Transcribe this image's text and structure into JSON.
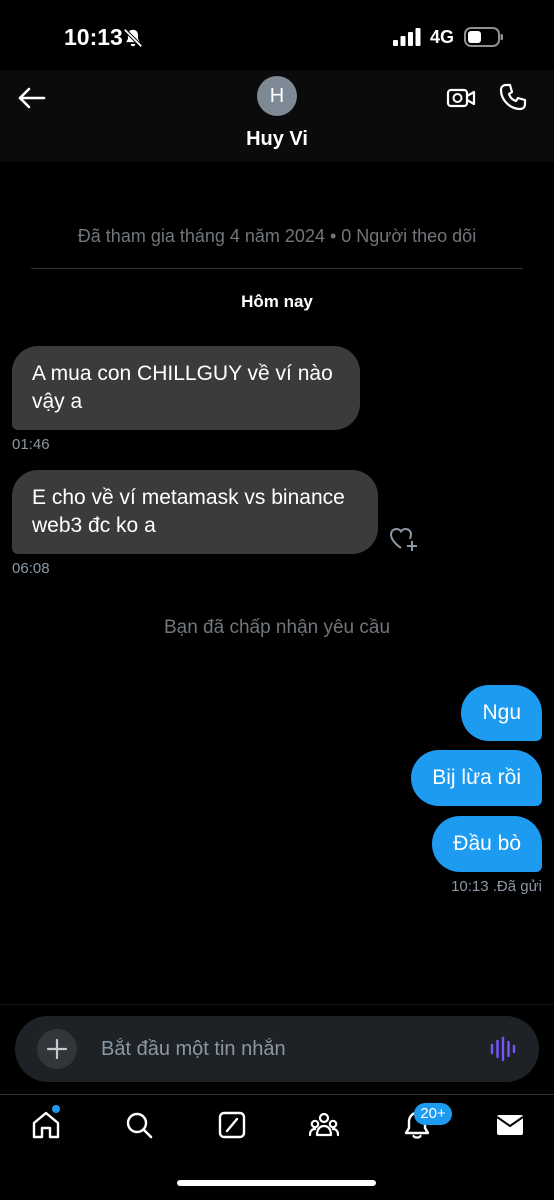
{
  "status_bar": {
    "time": "10:13",
    "network": "4G"
  },
  "header": {
    "avatar_initial": "H",
    "contact_name": "Huy Vi"
  },
  "conversation": {
    "joined_info": "Đã tham gia tháng 4 năm 2024 • 0 Người theo dõi",
    "date_separator": "Hôm nay",
    "incoming": [
      {
        "text": "A mua con CHILLGUY về ví nào vậy a",
        "time": "01:46"
      },
      {
        "text": "E cho về ví metamask vs binance web3 đc ko a",
        "time": "06:08"
      }
    ],
    "system_message": "Bạn đã chấp nhận yêu cầu",
    "outgoing": [
      {
        "text": "Ngu"
      },
      {
        "text": "Bij lừa rồi"
      },
      {
        "text": "Đầu bò"
      }
    ],
    "sent_status": "10:13  .Đã gửi"
  },
  "composer": {
    "placeholder": "Bắt đầu một tin nhắn"
  },
  "tab_bar": {
    "notifications_badge": "20+"
  },
  "colors": {
    "accent": "#1d9bf0",
    "incoming_bubble": "#3a3b3c",
    "voice_icon": "#7856ff",
    "muted_text": "#71767b"
  }
}
